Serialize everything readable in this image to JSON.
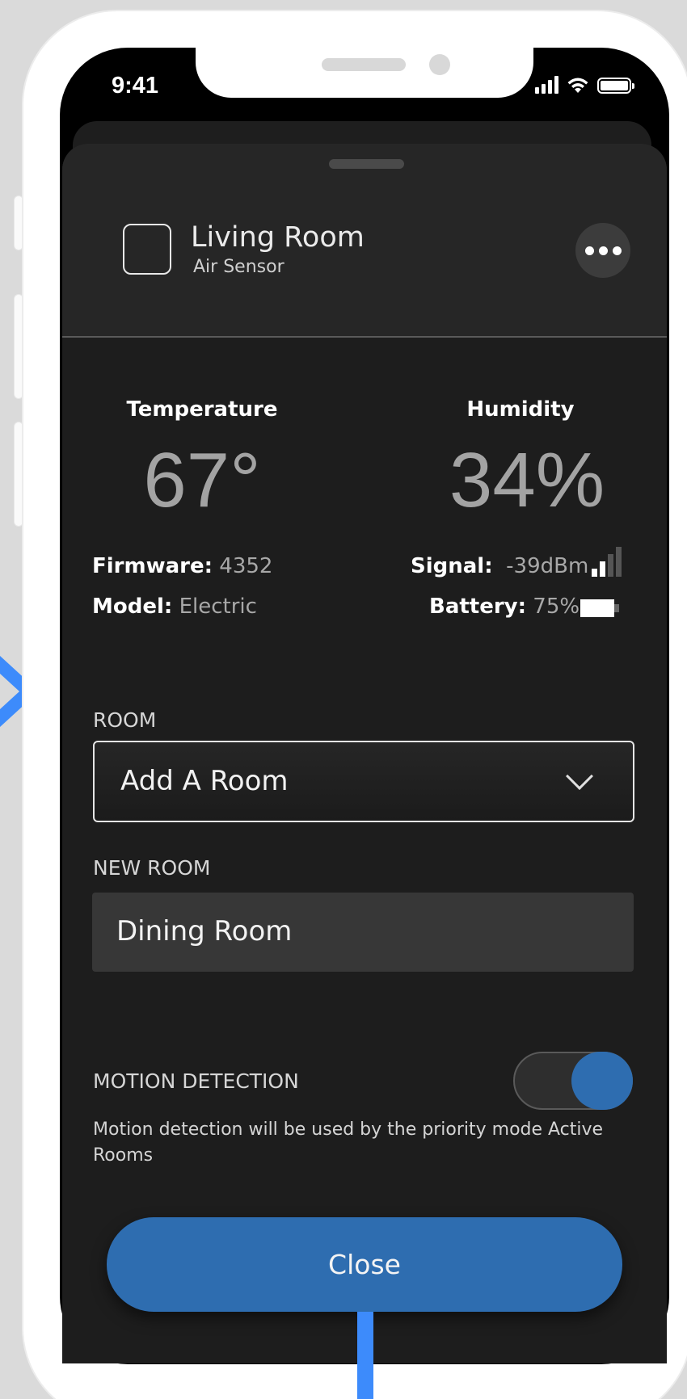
{
  "status_bar": {
    "time": "9:41"
  },
  "device": {
    "name": "Living Room",
    "type": "Air Sensor"
  },
  "metrics": {
    "temperature": {
      "label": "Temperature",
      "value": "67°"
    },
    "humidity": {
      "label": "Humidity",
      "value": "34%"
    }
  },
  "info": {
    "firmware_label": "Firmware:",
    "firmware_value": "4352",
    "model_label": "Model:",
    "model_value": "Electric",
    "signal_label": "Signal:",
    "signal_value": "-39dBm",
    "battery_label": "Battery:",
    "battery_value": "75%",
    "signal_strength_bars": 2,
    "signal_total_bars": 4
  },
  "room_section": {
    "label": "ROOM",
    "selected": "Add A Room"
  },
  "new_room_section": {
    "label": "NEW ROOM",
    "value": "Dining Room"
  },
  "motion": {
    "label": "MOTION DETECTION",
    "enabled": true,
    "description": "Motion detection will be used by the priority mode Active Rooms"
  },
  "actions": {
    "close_label": "Close"
  },
  "icons": [
    "more-icon",
    "signal-bars-icon",
    "battery-icon",
    "chevron-down-icon",
    "wifi-icon",
    "cellular-icon"
  ],
  "colors": {
    "accent": "#2e6db0",
    "annotation": "#3d8bfb",
    "sheet": "#1d1d1d",
    "header": "#262626"
  }
}
